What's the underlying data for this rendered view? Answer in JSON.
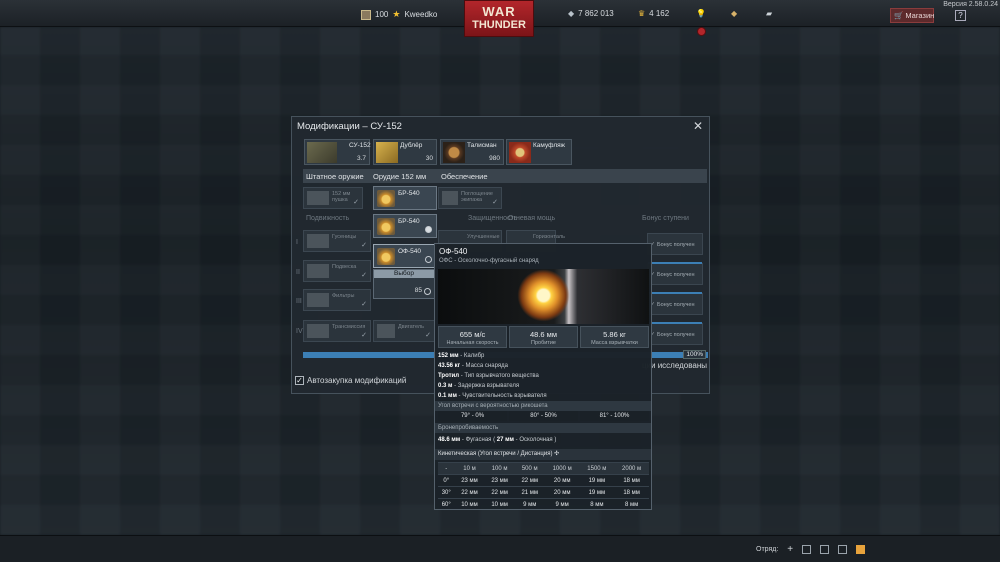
{
  "topbar": {
    "version": "Версия 2.58.0.24",
    "rank_level": "100",
    "player_name": "Kweedko",
    "logo_line1": "WAR",
    "logo_line2": "THUNDER",
    "silver_lions": "7 862 013",
    "golden_eagles": "4 162",
    "shop_label": "Магазин",
    "help_label": "?"
  },
  "bottombar": {
    "squad_label": "Отряд:"
  },
  "dialog": {
    "title": "Модификации – СУ-152",
    "close": "✕",
    "slots": [
      {
        "name": "СУ-152",
        "value": "3.7"
      },
      {
        "name": "Дублёр",
        "value": "30"
      },
      {
        "name": "Талисман",
        "value": "980"
      },
      {
        "name": "Камуфляж",
        "value": ""
      }
    ],
    "tabs": [
      "Штатное оружие",
      "Орудие 152 мм",
      "Обеспечение"
    ],
    "column_headers": [
      "Подвижность",
      "Защищенность",
      "Огневая мощь",
      "Бонус ступени"
    ],
    "rows": [
      "I",
      "II",
      "III",
      "IV"
    ],
    "standard_weapon": "152 мм пушка",
    "support_item": "Поглощение экипажа",
    "mobility_items": [
      "Гусеницы",
      "Подвеска",
      "Фильтры",
      "Трансмиссия"
    ],
    "engine_item": "Двигатель",
    "protection_item": "Улучшенные",
    "fire_item": "Горизонталь",
    "shells": [
      {
        "name": "БР-540",
        "selected": false
      },
      {
        "name": "БР-540",
        "selected": true
      },
      {
        "name": "ОФ-540",
        "selected": false
      }
    ],
    "choose_label": "Выбор",
    "choose_count": "85",
    "bonus_items": [
      "Бонус получен",
      "Бонус получен",
      "Бонус получен",
      "Бонус получен"
    ],
    "progress_pct": "100%",
    "progress_value": 1.0,
    "auto_buy_label": "Автозакупка модификаций",
    "researched_label": "ции исследованы"
  },
  "tooltip": {
    "title": "ОФ-540",
    "subtitle": "ОФС - Осколочно-фугасный снаряд",
    "stats": [
      {
        "value": "655 м/с",
        "label": "Начальная скорость"
      },
      {
        "value": "48.6 мм",
        "label": "Пробитие"
      },
      {
        "value": "5.86 кг",
        "label": "Масса взрывчатки"
      }
    ],
    "specs": [
      {
        "value": "152 мм",
        "label": " - Калибр"
      },
      {
        "value": "43.56 кг",
        "label": " - Масса снаряда"
      },
      {
        "value": "Тротил",
        "label": " - Тип взрывчатого вещества"
      },
      {
        "value": "0.3 м",
        "label": " - Задержка взрывателя"
      },
      {
        "value": "0.1 мм",
        "label": " - Чувствительность взрывателя"
      }
    ],
    "ricochet_header": "Угол встречи с вероятностью рикошета",
    "ricochet": [
      "79° - 0%",
      "80° - 50%",
      "81° - 100%"
    ],
    "penetration_header": "Бронепробиваемость",
    "penetration_line_a": "48.6 мм",
    "penetration_line_b": " - Фугасная ( ",
    "penetration_line_c": "27 мм",
    "penetration_line_d": " - Осколочная )",
    "kinetic_header": "Кинетическая (Угол встречи / Дистанция)",
    "table_header": [
      "-",
      "10 м",
      "100 м",
      "500 м",
      "1000 м",
      "1500 м",
      "2000 м"
    ],
    "table_rows": [
      [
        "0°",
        "23 мм",
        "23 мм",
        "22 мм",
        "20 мм",
        "19 мм",
        "18 мм"
      ],
      [
        "30°",
        "22 мм",
        "22 мм",
        "21 мм",
        "20 мм",
        "19 мм",
        "18 мм"
      ],
      [
        "60°",
        "10 мм",
        "10 мм",
        "9 мм",
        "9 мм",
        "8 мм",
        "8 мм"
      ]
    ]
  }
}
